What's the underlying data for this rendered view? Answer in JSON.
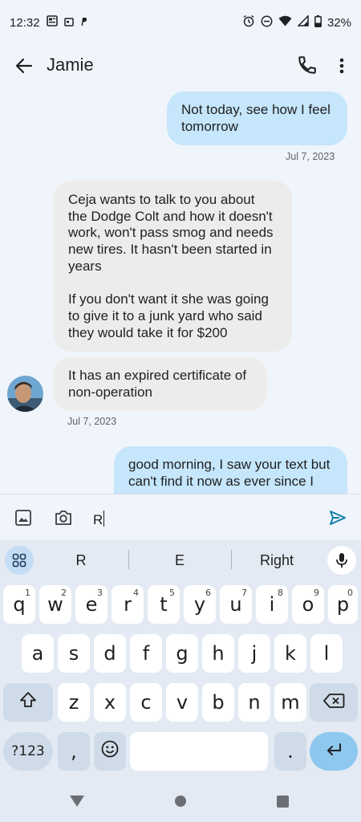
{
  "status_bar": {
    "time": "12:32",
    "battery": "32%"
  },
  "header": {
    "contact_name": "Jamie"
  },
  "messages": [
    {
      "from": "me",
      "lines": [
        "Not today, see how I feel",
        "tomorrow"
      ]
    },
    {
      "timestamp": "Jul 7, 2023"
    },
    {
      "from": "Jamie",
      "lines": [
        "Ceja wants to talk to you about",
        "the Dodge Colt and how it doesn't",
        "work, won't pass smog and needs",
        "new tires. It hasn't been started in",
        "years",
        "",
        "If you don't want it she was going",
        "to give it to a junk yard who said",
        "they would take it for $200"
      ]
    },
    {
      "from": "Jamie",
      "lines": [
        "It has an expired certificate of",
        "non-operation"
      ]
    },
    {
      "timestamp": "Jul 7, 2023"
    },
    {
      "from": "me",
      "lines": [
        "good morning, I saw your text but",
        "can't find it now as ever since I"
      ]
    }
  ],
  "compose": {
    "input_value": "R"
  },
  "keyboard": {
    "suggestions": [
      "R",
      "E",
      "Right"
    ],
    "row1": [
      {
        "key": "q",
        "hint": "1"
      },
      {
        "key": "w",
        "hint": "2"
      },
      {
        "key": "e",
        "hint": "3"
      },
      {
        "key": "r",
        "hint": "4"
      },
      {
        "key": "t",
        "hint": "5"
      },
      {
        "key": "y",
        "hint": "6"
      },
      {
        "key": "u",
        "hint": "7"
      },
      {
        "key": "i",
        "hint": "8"
      },
      {
        "key": "o",
        "hint": "9"
      },
      {
        "key": "p",
        "hint": "0"
      }
    ],
    "row2": [
      "a",
      "s",
      "d",
      "f",
      "g",
      "h",
      "j",
      "k",
      "l"
    ],
    "row3": [
      "z",
      "x",
      "c",
      "v",
      "b",
      "n",
      "m"
    ],
    "symbols_label": "?123",
    "comma": ",",
    "period": "."
  },
  "colors": {
    "sent_bubble": "#c5e6fb",
    "received_bubble": "#ececec",
    "background": "#f0f4fb",
    "keyboard_bg": "#e3eaf3",
    "send_accent": "#0b7fa8"
  },
  "icons": [
    "back-arrow-icon",
    "phone-icon",
    "more-vert-icon",
    "gallery-icon",
    "camera-icon",
    "send-icon",
    "apps-grid-icon",
    "mic-icon",
    "shift-icon",
    "backspace-icon",
    "emoji-icon",
    "enter-icon"
  ]
}
